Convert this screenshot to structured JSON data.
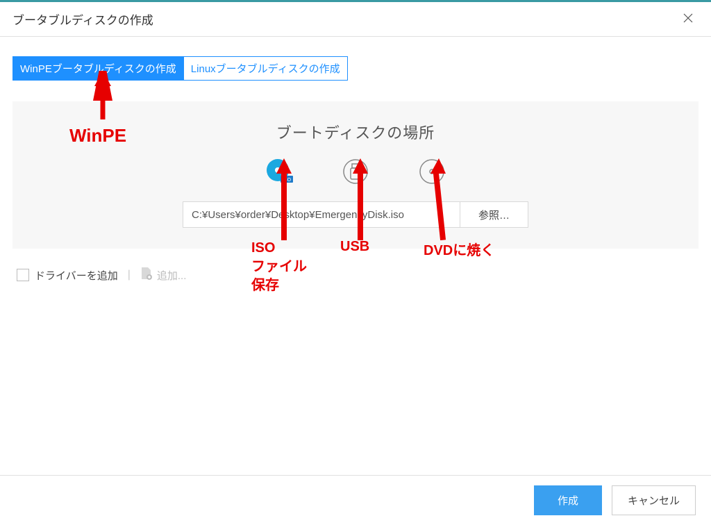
{
  "window": {
    "title": "ブータブルディスクの作成"
  },
  "tabs": {
    "winpe": "WinPEブータブルディスクの作成",
    "linux": "Linuxブータブルディスクの作成"
  },
  "panel": {
    "title": "ブートディスクの場所",
    "path_value": "C:¥Users¥order¥Desktop¥EmergencyDisk.iso",
    "browse": "参照…"
  },
  "driver": {
    "label": "ドライバーを追加",
    "add": "追加..."
  },
  "footer": {
    "create": "作成",
    "cancel": "キャンセル"
  },
  "annotations": {
    "winpe": "WinPE",
    "iso": "ISO\nファイル\n保存",
    "usb": "USB",
    "dvd": "DVDに焼く"
  }
}
